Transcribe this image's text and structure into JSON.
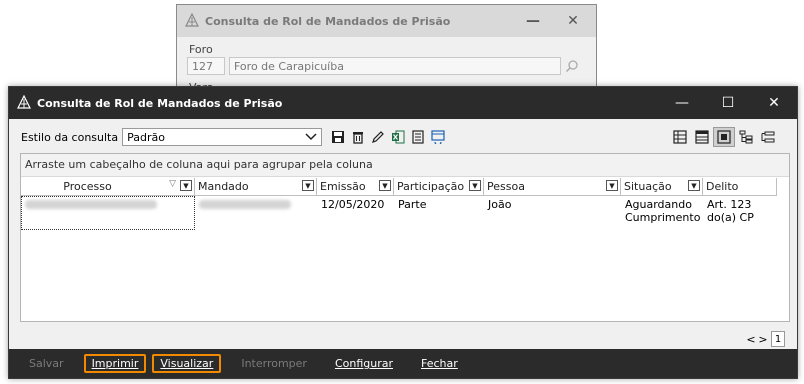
{
  "background_dialog": {
    "title": "Consulta de Rol de Mandados de Prisão",
    "field_label": "Foro",
    "code": "127",
    "name": "Foro de Carapicuíba",
    "partial_label": "Vara"
  },
  "window": {
    "title": "Consulta de Rol de Mandados de Prisão"
  },
  "toolbar": {
    "style_label": "Estilo da consulta",
    "style_value": "Padrão",
    "icons": [
      "save-icon",
      "delete-icon",
      "edit-icon",
      "excel-export-icon",
      "document-icon",
      "refresh-table-icon"
    ],
    "view_icons": [
      "table-view-icon",
      "list-view-icon",
      "detail-view-icon",
      "tree-view-icon",
      "group-view-icon"
    ]
  },
  "grid": {
    "group_hint": "Arraste um cabeçalho de coluna aqui para agrupar pela coluna",
    "columns": [
      "Processo",
      "Mandado",
      "Emissão",
      "Participação",
      "Pessoa",
      "Situação",
      "Delito"
    ],
    "rows": [
      {
        "processo": "",
        "mandado": "",
        "emissao": "12/05/2020",
        "participacao": "Parte",
        "pessoa": "João",
        "situacao": "Aguardando Cumprimento",
        "delito": "Art. 123 do(a) CP"
      }
    ]
  },
  "pager": {
    "prev": "<",
    "next": ">",
    "page": "1"
  },
  "buttons": {
    "salvar": "Salvar",
    "imprimir": "Imprimir",
    "visualizar": "Visualizar",
    "interromper": "Interromper",
    "configurar": "Configurar",
    "fechar": "Fechar"
  },
  "colors": {
    "title_bar": "#2b2b2b",
    "highlight": "#f28a00"
  }
}
